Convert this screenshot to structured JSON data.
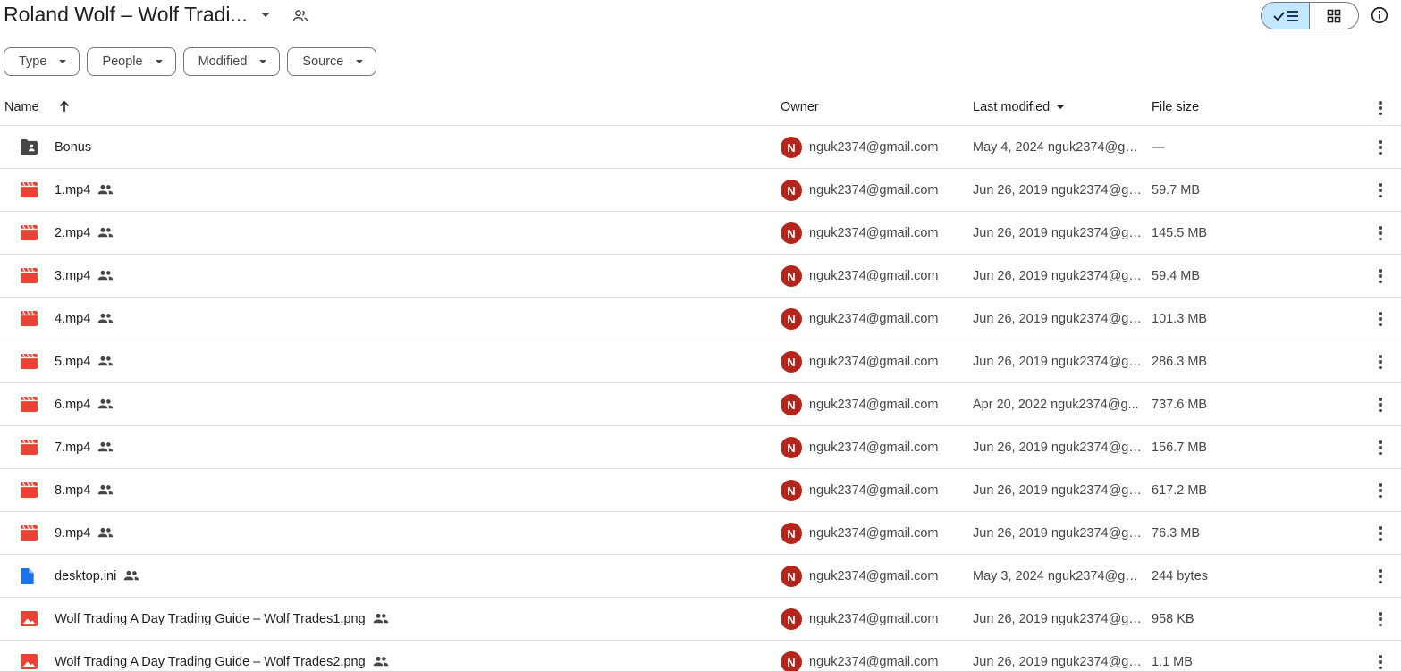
{
  "header": {
    "title": "Roland Wolf – Wolf Tradi...",
    "title_caret_icon": "arrow-drop-down-icon",
    "shared_icon": "people-icon",
    "view_toggle": {
      "list_icon": "check-list-icon",
      "grid_icon": "grid-icon",
      "active": "list"
    },
    "info_icon": "info-icon"
  },
  "filters": [
    {
      "label": "Type"
    },
    {
      "label": "People"
    },
    {
      "label": "Modified"
    },
    {
      "label": "Source"
    }
  ],
  "columns": {
    "name": "Name",
    "owner": "Owner",
    "last_modified": "Last modified",
    "file_size": "File size"
  },
  "colors": {
    "accent_selected": "#c2e7ff",
    "video_icon": "#ea4335",
    "doc_icon": "#1a73e8",
    "avatar": "#b3261e",
    "divider": "#e0e0e0"
  },
  "files": [
    {
      "icon": "folder-shared-icon",
      "name": "Bonus",
      "shared": false,
      "avatar": "N",
      "owner": "nguk2374@gmail.com",
      "modified": "May 4, 2024 nguk2374@gm...",
      "size": "—"
    },
    {
      "icon": "video-icon",
      "name": "1.mp4",
      "shared": true,
      "avatar": "N",
      "owner": "nguk2374@gmail.com",
      "modified": "Jun 26, 2019 nguk2374@gm...",
      "size": "59.7 MB"
    },
    {
      "icon": "video-icon",
      "name": "2.mp4",
      "shared": true,
      "avatar": "N",
      "owner": "nguk2374@gmail.com",
      "modified": "Jun 26, 2019 nguk2374@gm...",
      "size": "145.5 MB"
    },
    {
      "icon": "video-icon",
      "name": "3.mp4",
      "shared": true,
      "avatar": "N",
      "owner": "nguk2374@gmail.com",
      "modified": "Jun 26, 2019 nguk2374@gm...",
      "size": "59.4 MB"
    },
    {
      "icon": "video-icon",
      "name": "4.mp4",
      "shared": true,
      "avatar": "N",
      "owner": "nguk2374@gmail.com",
      "modified": "Jun 26, 2019 nguk2374@gm...",
      "size": "101.3 MB"
    },
    {
      "icon": "video-icon",
      "name": "5.mp4",
      "shared": true,
      "avatar": "N",
      "owner": "nguk2374@gmail.com",
      "modified": "Jun 26, 2019 nguk2374@gm...",
      "size": "286.3 MB"
    },
    {
      "icon": "video-icon",
      "name": "6.mp4",
      "shared": true,
      "avatar": "N",
      "owner": "nguk2374@gmail.com",
      "modified": "Apr 20, 2022 nguk2374@g...",
      "size": "737.6 MB"
    },
    {
      "icon": "video-icon",
      "name": "7.mp4",
      "shared": true,
      "avatar": "N",
      "owner": "nguk2374@gmail.com",
      "modified": "Jun 26, 2019 nguk2374@gm...",
      "size": "156.7 MB"
    },
    {
      "icon": "video-icon",
      "name": "8.mp4",
      "shared": true,
      "avatar": "N",
      "owner": "nguk2374@gmail.com",
      "modified": "Jun 26, 2019 nguk2374@gm...",
      "size": "617.2 MB"
    },
    {
      "icon": "video-icon",
      "name": "9.mp4",
      "shared": true,
      "avatar": "N",
      "owner": "nguk2374@gmail.com",
      "modified": "Jun 26, 2019 nguk2374@gm...",
      "size": "76.3 MB"
    },
    {
      "icon": "document-icon",
      "name": "desktop.ini",
      "shared": true,
      "avatar": "N",
      "owner": "nguk2374@gmail.com",
      "modified": "May 3, 2024 nguk2374@gm...",
      "size": "244 bytes"
    },
    {
      "icon": "image-icon",
      "name": "Wolf Trading  A Day Trading Guide – Wolf Trades1.png",
      "shared": true,
      "avatar": "N",
      "owner": "nguk2374@gmail.com",
      "modified": "Jun 26, 2019 nguk2374@gm...",
      "size": "958 KB"
    },
    {
      "icon": "image-icon",
      "name": "Wolf Trading  A Day Trading Guide – Wolf Trades2.png",
      "shared": true,
      "avatar": "N",
      "owner": "nguk2374@gmail.com",
      "modified": "Jun 26, 2019 nguk2374@gm...",
      "size": "1.1 MB"
    }
  ]
}
